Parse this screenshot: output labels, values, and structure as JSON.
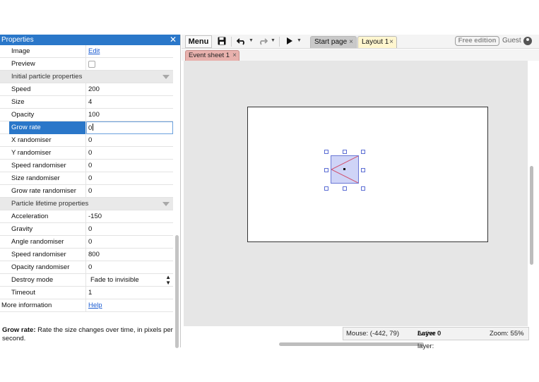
{
  "panel": {
    "title": "Properties",
    "close_glyph": "✕",
    "rows": {
      "image": {
        "label": "Image",
        "value": "Edit"
      },
      "preview": {
        "label": "Preview"
      },
      "section_initial": {
        "label": "Initial particle properties"
      },
      "speed": {
        "label": "Speed",
        "value": "200"
      },
      "size": {
        "label": "Size",
        "value": "4"
      },
      "opacity": {
        "label": "Opacity",
        "value": "100"
      },
      "grow_rate": {
        "label": "Grow rate",
        "value": "0"
      },
      "x_randomiser": {
        "label": "X randomiser",
        "value": "0"
      },
      "y_randomiser": {
        "label": "Y randomiser",
        "value": "0"
      },
      "speed_randomiser": {
        "label": "Speed randomiser",
        "value": "0"
      },
      "size_randomiser": {
        "label": "Size randomiser",
        "value": "0"
      },
      "grow_rate_randomiser": {
        "label": "Grow rate randomiser",
        "value": "0"
      },
      "section_lifetime": {
        "label": "Particle lifetime properties"
      },
      "acceleration": {
        "label": "Acceleration",
        "value": "-150"
      },
      "gravity": {
        "label": "Gravity",
        "value": "0"
      },
      "angle_randomiser": {
        "label": "Angle randomiser",
        "value": "0"
      },
      "speed_randomiser_2": {
        "label": "Speed randomiser",
        "value": "800"
      },
      "opacity_randomiser": {
        "label": "Opacity randomiser",
        "value": "0"
      },
      "destroy_mode": {
        "label": "Destroy mode",
        "value": "Fade to invisible"
      },
      "timeout": {
        "label": "Timeout",
        "value": "1"
      },
      "more_info": {
        "label": "More information",
        "value": "Help"
      }
    },
    "help": {
      "term": "Grow rate:",
      "text": " Rate the size changes over time, in pixels per second."
    }
  },
  "toolbar": {
    "menu_label": "Menu",
    "icons": {
      "save": "save-icon",
      "undo": "undo-icon",
      "redo": "redo-icon",
      "play": "play-icon",
      "account": "user-icon"
    },
    "tabs": [
      {
        "label": "Start page",
        "close": "×"
      },
      {
        "label": "Layout 1",
        "close": "×"
      }
    ],
    "edition_badge": "Free edition",
    "user": "Guest"
  },
  "subtabs": [
    {
      "label": "Event sheet 1",
      "close": "×"
    }
  ],
  "status": {
    "mouse": "Mouse: (-442, 79)",
    "layer_prefix": "Active layer: ",
    "layer_name": "Layer 0",
    "zoom": "Zoom: 55%"
  },
  "colors": {
    "accent": "#2a77c9",
    "layout_tab": "#fff6cf",
    "event_tab": "#e8b1ad",
    "sprite_fill": "#cfd4f7",
    "link": "#1a5bd1"
  }
}
